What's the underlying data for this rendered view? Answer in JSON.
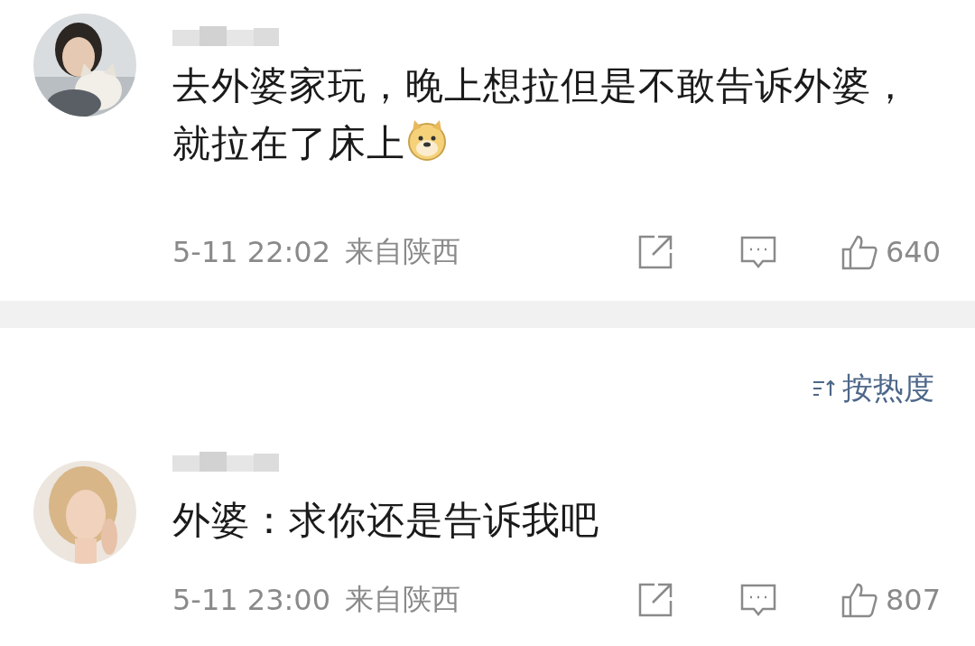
{
  "comments": [
    {
      "text": "去外婆家玩，晚上想拉但是不敢告诉外婆，就拉在了床上",
      "emoji": true,
      "time": "5-11 22:02",
      "location": "来自陕西",
      "likes": "640"
    },
    {
      "text": "外婆：求你还是告诉我吧",
      "time": "5-11 23:00",
      "location": "来自陕西",
      "likes": "807"
    }
  ],
  "sort": {
    "label": "按热度"
  }
}
